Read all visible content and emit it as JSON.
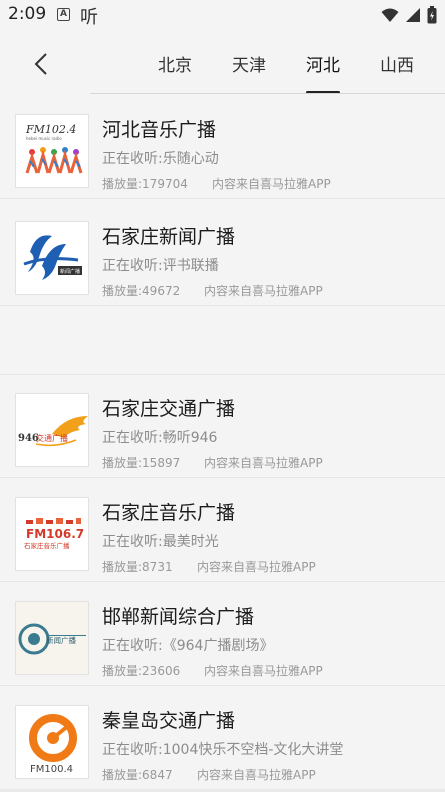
{
  "status": {
    "time": "2:09",
    "a_icon": "A",
    "ting": "听"
  },
  "header": {
    "back_icon": "chevron-left",
    "tabs": [
      {
        "label": "北京"
      },
      {
        "label": "天津"
      },
      {
        "label": "河北",
        "active": true
      },
      {
        "label": "山西"
      }
    ]
  },
  "stations": [
    {
      "title": "河北音乐广播",
      "now_playing": "正在收听:乐随心动",
      "plays": "播放量:179704",
      "source": "内容来自喜马拉雅APP",
      "logo": "FM102.4 音乐广播"
    },
    {
      "title": "石家庄新闻广播",
      "now_playing": "正在收听:评书联播",
      "plays": "播放量:49672",
      "source": "内容来自喜马拉雅APP",
      "logo": "新闻广播"
    },
    {
      "title": "石家庄交通广播",
      "now_playing": "正在收听:畅听946",
      "plays": "播放量:15897",
      "source": "内容来自喜马拉雅APP",
      "logo": "946交通广播"
    },
    {
      "title": "石家庄音乐广播",
      "now_playing": "正在收听:最美时光",
      "plays": "播放量:8731",
      "source": "内容来自喜马拉雅APP",
      "logo": "FM106.7 石家庄音乐广播"
    },
    {
      "title": "邯郸新闻综合广播",
      "now_playing": "正在收听:《964广播剧场》",
      "plays": "播放量:23606",
      "source": "内容来自喜马拉雅APP",
      "logo": "新闻广播"
    },
    {
      "title": "秦皇岛交通广播",
      "now_playing": "正在收听:1004快乐不空档-文化大讲堂",
      "plays": "播放量:6847",
      "source": "内容来自喜马拉雅APP",
      "logo": "FM100.4"
    }
  ]
}
